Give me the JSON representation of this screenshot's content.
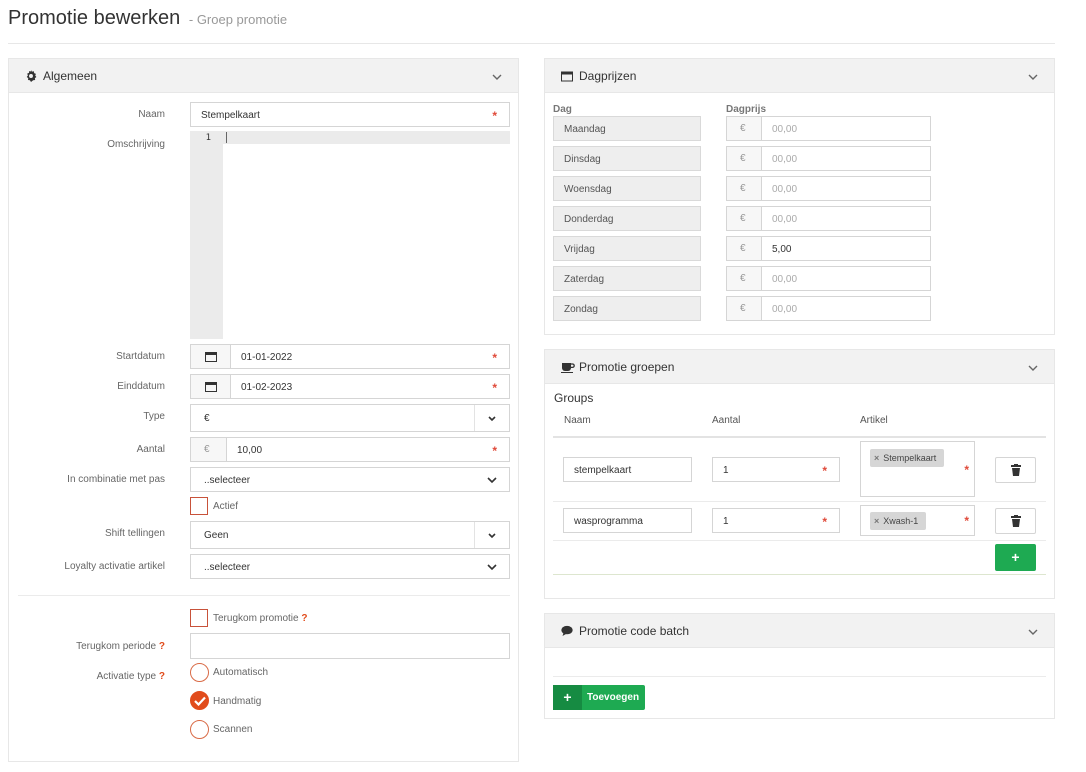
{
  "header": {
    "title": "Promotie bewerken",
    "subtitle": "- Groep promotie"
  },
  "general": {
    "panel_title": "Algemeen",
    "name_label": "Naam",
    "name_value": "Stempelkaart",
    "description_label": "Omschrijving",
    "editor_line": "1",
    "start_label": "Startdatum",
    "start_value": "01-01-2022",
    "end_label": "Einddatum",
    "end_value": "01-02-2023",
    "type_label": "Type",
    "type_value": "€",
    "amount_label": "Aantal",
    "amount_prefix": "€",
    "amount_value": "10,00",
    "combo_label": "In combinatie met pas",
    "combo_value": "..selecteer",
    "active_label": "Actief",
    "shift_label": "Shift tellingen",
    "shift_value": "Geen",
    "loyalty_label": "Loyalty activatie artikel",
    "loyalty_value": "..selecteer",
    "return_label": "Terugkom promotie",
    "return_help": "?",
    "return_period_label": "Terugkom periode",
    "return_period_help": "?",
    "return_period_value": "",
    "activation_label": "Activatie type",
    "activation_help": "?",
    "activation_options": [
      {
        "label": "Automatisch",
        "selected": false
      },
      {
        "label": "Handmatig",
        "selected": true
      },
      {
        "label": "Scannen",
        "selected": false
      }
    ],
    "required_mark": "*"
  },
  "day_prices": {
    "panel_title": "Dagprijzen",
    "col_day": "Dag",
    "col_price": "Dagprijs",
    "currency": "€",
    "days": [
      {
        "day": "Maandag",
        "price": "00,00",
        "filled": false
      },
      {
        "day": "Dinsdag",
        "price": "00,00",
        "filled": false
      },
      {
        "day": "Woensdag",
        "price": "00,00",
        "filled": false
      },
      {
        "day": "Donderdag",
        "price": "00,00",
        "filled": false
      },
      {
        "day": "Vrijdag",
        "price": "5,00",
        "filled": true
      },
      {
        "day": "Zaterdag",
        "price": "00,00",
        "filled": false
      },
      {
        "day": "Zondag",
        "price": "00,00",
        "filled": false
      }
    ]
  },
  "groups": {
    "panel_title": "Promotie groepen",
    "heading": "Groups",
    "col_name": "Naam",
    "col_amount": "Aantal",
    "col_article": "Artikel",
    "rows": [
      {
        "name": "stempelkaart",
        "amount": "1",
        "article": "Stempelkaart"
      },
      {
        "name": "wasprogramma",
        "amount": "1",
        "article": "Xwash-1"
      }
    ],
    "tag_remove": "×",
    "add_label": "+"
  },
  "code_batch": {
    "panel_title": "Promotie code batch",
    "add_icon": "+",
    "add_label": "Toevoegen"
  },
  "colors": {
    "accent": "#e14c1c",
    "green": "#1eaa52",
    "dark_green": "#168b42"
  }
}
